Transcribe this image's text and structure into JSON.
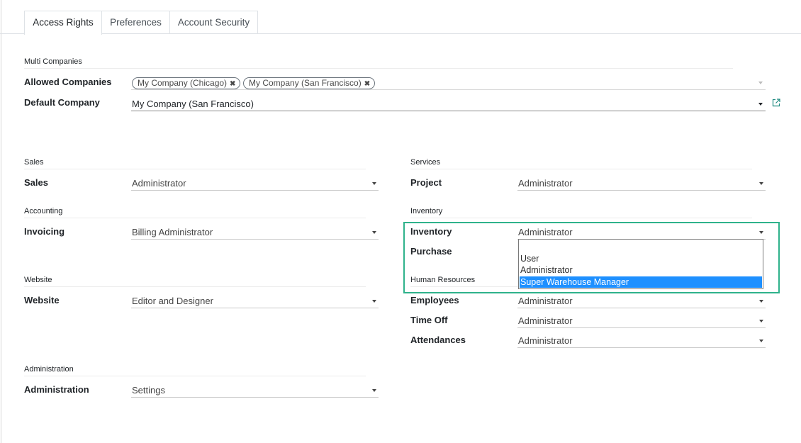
{
  "tabs": [
    {
      "label": "Access Rights",
      "active": true
    },
    {
      "label": "Preferences",
      "active": false
    },
    {
      "label": "Account Security",
      "active": false
    }
  ],
  "multi_companies": {
    "title": "Multi Companies",
    "allowed_label": "Allowed Companies",
    "allowed_tags": [
      "My Company (Chicago)",
      "My Company (San Francisco)"
    ],
    "default_label": "Default Company",
    "default_value": "My Company (San Francisco)"
  },
  "left": {
    "sales_title": "Sales",
    "sales_label": "Sales",
    "sales_value": "Administrator",
    "accounting_title": "Accounting",
    "invoicing_label": "Invoicing",
    "invoicing_value": "Billing Administrator",
    "website_title": "Website",
    "website_label": "Website",
    "website_value": "Editor and Designer",
    "administration_title": "Administration",
    "administration_label": "Administration",
    "administration_value": "Settings"
  },
  "right": {
    "services_title": "Services",
    "project_label": "Project",
    "project_value": "Administrator",
    "inventory_title": "Inventory",
    "inventory_label": "Inventory",
    "inventory_value": "Administrator",
    "purchase_label": "Purchase",
    "hr_title": "Human Resources",
    "employees_label": "Employees",
    "employees_value": "Administrator",
    "timeoff_label": "Time Off",
    "timeoff_value": "Administrator",
    "attendances_label": "Attendances",
    "attendances_value": "Administrator"
  },
  "dropdown": {
    "options": [
      "",
      "User",
      "Administrator",
      "Super Warehouse Manager"
    ],
    "selected": "Super Warehouse Manager"
  },
  "colors": {
    "highlight": "#2fb28b",
    "selected_option": "#1e90ff"
  },
  "icons": {
    "tag_remove": "close-icon",
    "caret": "chevron-down-icon",
    "external": "external-link-icon"
  }
}
